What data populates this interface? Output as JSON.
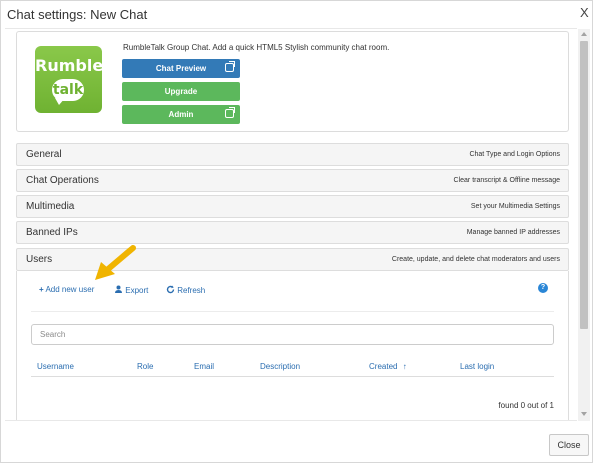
{
  "dialog": {
    "title": "Chat settings: New Chat",
    "close_symbol": "X",
    "close_button_label": "Close"
  },
  "app": {
    "logo_top": "Rumble",
    "logo_bottom": "talk",
    "description": "RumbleTalk Group Chat. Add a quick HTML5 Stylish community chat room.",
    "buttons": {
      "chat_preview": "Chat Preview",
      "upgrade": "Upgrade",
      "admin": "Admin"
    }
  },
  "panels": [
    {
      "title": "General",
      "detail": "Chat Type and Login Options"
    },
    {
      "title": "Chat Operations",
      "detail": "Clear transcript & Offline message"
    },
    {
      "title": "Multimedia",
      "detail": "Set your Multimedia Settings"
    },
    {
      "title": "Banned IPs",
      "detail": "Manage banned IP addresses"
    },
    {
      "title": "Users",
      "detail": "Create, update, and delete chat moderators and users"
    }
  ],
  "users": {
    "add_label": "Add new user",
    "export_label": "Export",
    "refresh_label": "Refresh",
    "help_symbol": "?",
    "search_placeholder": "Search",
    "columns": {
      "username": "Username",
      "role": "Role",
      "email": "Email",
      "description": "Description",
      "created": "Created",
      "sort_symbol": "↑",
      "last_login": "Last login"
    },
    "found_text": "found 0 out of 1"
  },
  "colors": {
    "blue_button": "#337ab7",
    "green_button": "#5cb85c",
    "link": "#2a6db0",
    "arrow": "#f0b400"
  }
}
